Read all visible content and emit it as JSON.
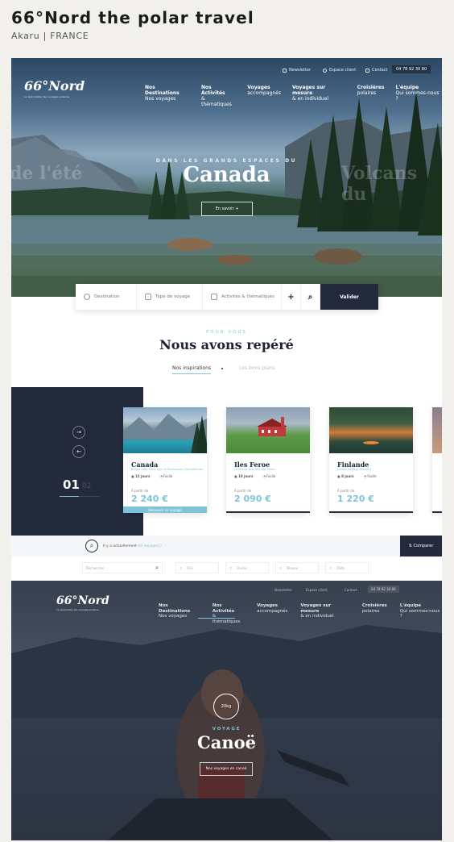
{
  "header": {
    "title": "66°Nord the polar travel",
    "subtitle": "Akaru  |  FRANCE"
  },
  "hero": {
    "logo": "66°Nord",
    "logo_tagline": "Le spécialiste des voyages polaires",
    "util": {
      "newsletter": "Newsletter",
      "client": "Espace client",
      "contact": "Contact",
      "phone": "04 78 92 30 80"
    },
    "nav": [
      {
        "label": "Nos Destinations",
        "sub": "Nos voyages"
      },
      {
        "label": "Nos Activités",
        "sub": "& thématiques"
      },
      {
        "label": "Voyages",
        "sub": "accompagnés"
      },
      {
        "label": "Voyages sur mesure",
        "sub": "& en individuel"
      },
      {
        "label": "Croisières",
        "sub": "polaires"
      },
      {
        "label": "L'équipe",
        "sub": "Qui sommes-nous ?"
      }
    ],
    "ghost_left": "de l'été",
    "ghost_right": "Volcans du",
    "kicker": "DANS LES GRANDS ESPACES DU",
    "title": "Canada",
    "button": "En savoir +"
  },
  "search": {
    "destination": "Destination",
    "type": "Type de voyage",
    "activities": "Activités & thématiques",
    "plus": "+",
    "submit": "Valider"
  },
  "section": {
    "kicker": "POUR VOUS",
    "title": "Nous avons repéré",
    "tab_active": "Nos inspirations",
    "tab_inactive": "Les bons plans",
    "counter": "01",
    "counter_next": "02"
  },
  "cards": [
    {
      "name": "Canada",
      "desc": "Randonnée entre lacs et Rocheuses Canadiennes",
      "days": "15 jours",
      "level": "Facile",
      "from": "À partir de",
      "price": "2 240 €",
      "cta": "Découvrir ce voyage"
    },
    {
      "name": "Iles Feroe",
      "desc": "Le Grand tour des îles Feroe",
      "days": "10 jours",
      "level": "Facile",
      "from": "À partir de",
      "price": "2 090 €"
    },
    {
      "name": "Finlande",
      "desc": "Canoë au Pays des lacs",
      "days": "8 jours",
      "level": "Facile",
      "from": "À partir de",
      "price": "1 220 €"
    }
  ],
  "strip": {
    "text": "Il y a actuellement",
    "count": "64 voyage(s)",
    "compare": "Comparer"
  },
  "filters": {
    "search": "Rechercher",
    "prix": "Prix",
    "duree": "Durée",
    "niveau": "Niveau",
    "date": "Date"
  },
  "canoe": {
    "logo": "66°Nord",
    "logo_tagline": "Le spécialiste des voyages polaires",
    "util": {
      "newsletter": "Newsletter",
      "client": "Espace client",
      "contact": "Contact",
      "phone": "04 78 92 30 80"
    },
    "nav": [
      {
        "label": "Nos Destinations",
        "sub": "Nos voyages"
      },
      {
        "label": "Nos Activités",
        "sub": "& thématiques"
      },
      {
        "label": "Voyages",
        "sub": "accompagnés"
      },
      {
        "label": "Voyages sur mesure",
        "sub": "& en individuel"
      },
      {
        "label": "Croisières",
        "sub": "polaires"
      },
      {
        "label": "L'équipe",
        "sub": "Qui sommes-nous ?"
      }
    ],
    "badge": "20kg",
    "kicker": "VOYAGE",
    "title": "Canoë",
    "button": "Nos voyages en canoë"
  },
  "colors": {
    "accent": "#7ec4d6",
    "navy": "#232a3c"
  }
}
